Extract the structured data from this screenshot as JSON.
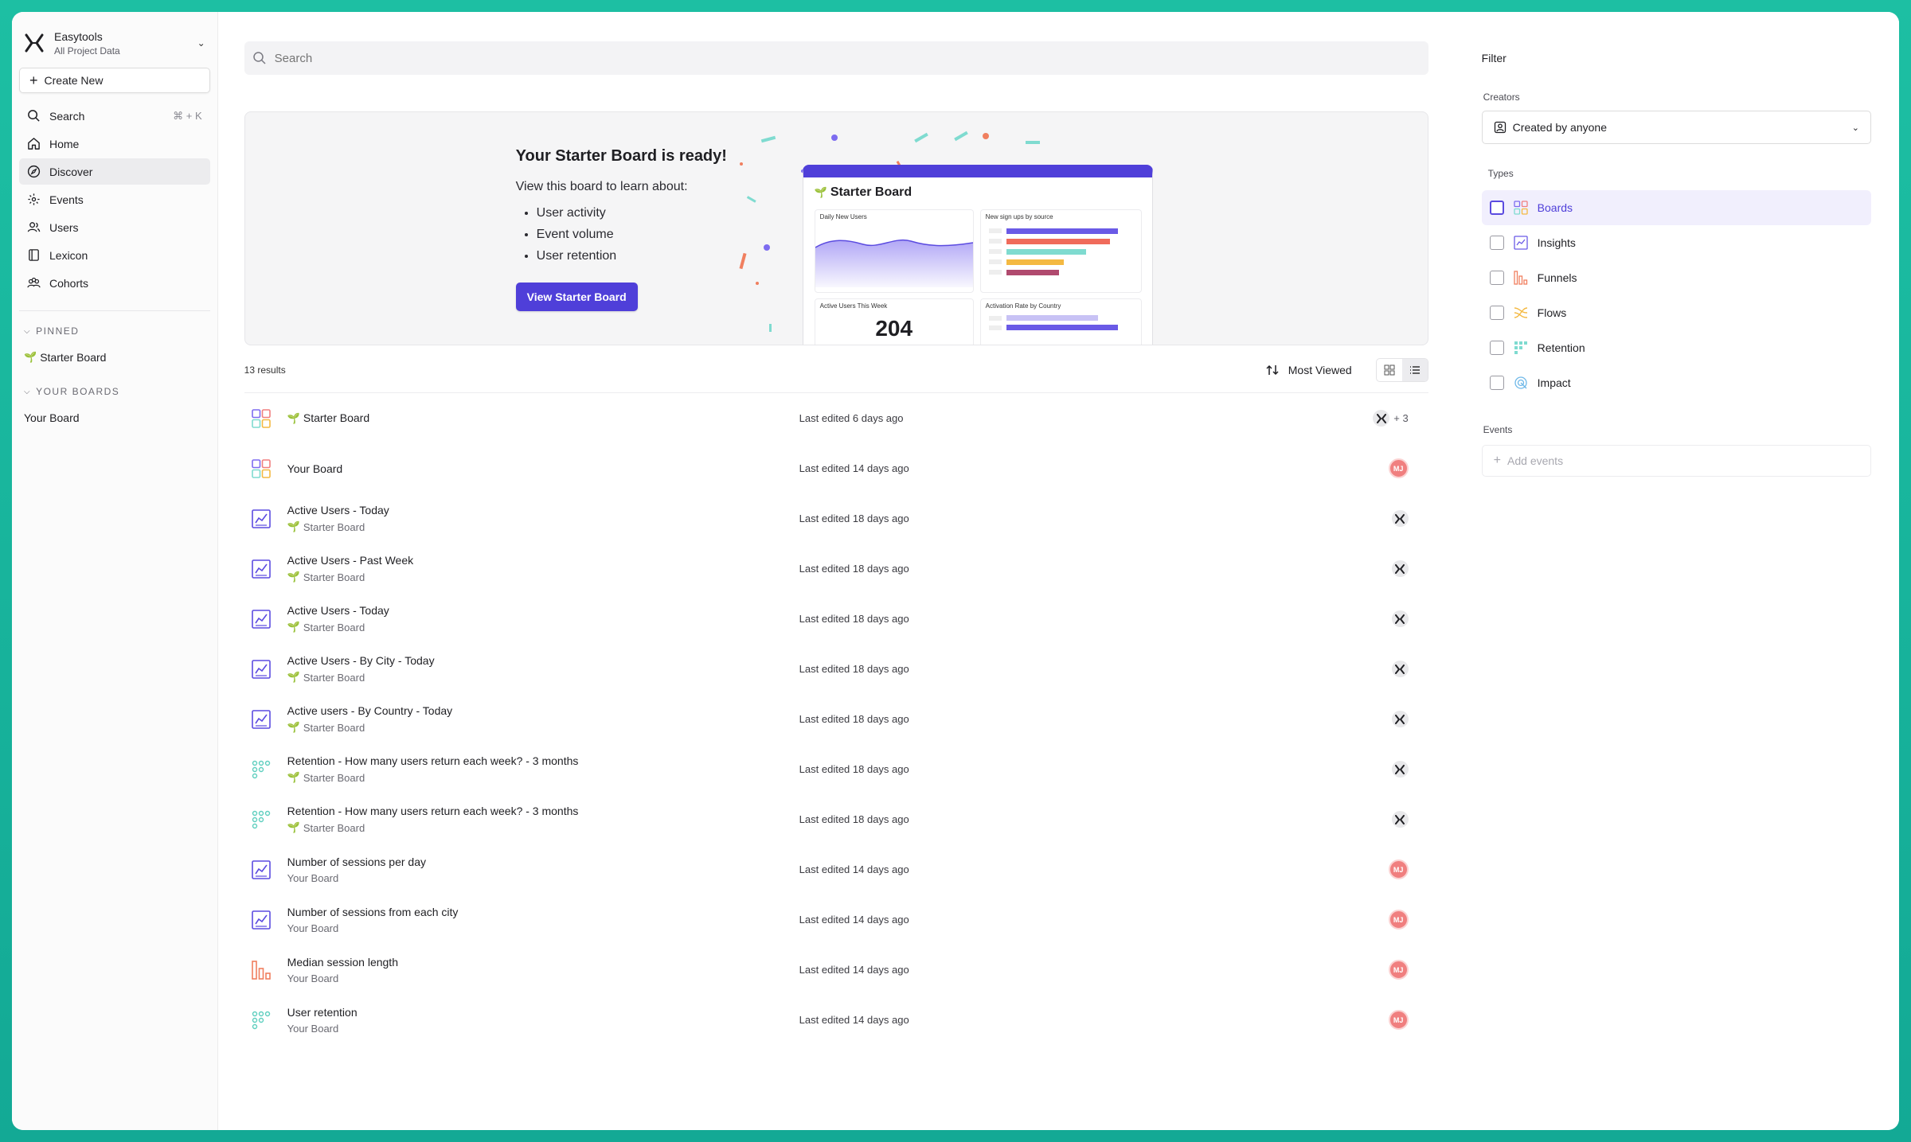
{
  "workspace": {
    "name": "Easytools",
    "subtitle": "All Project Data"
  },
  "sidebar": {
    "create_label": "Create New",
    "nav": [
      {
        "label": "Search",
        "icon": "search-icon",
        "shortcut": "⌘ + K"
      },
      {
        "label": "Home",
        "icon": "home-icon"
      },
      {
        "label": "Discover",
        "icon": "compass-icon",
        "active": true
      },
      {
        "label": "Events",
        "icon": "events-icon"
      },
      {
        "label": "Users",
        "icon": "users-icon"
      },
      {
        "label": "Lexicon",
        "icon": "book-icon"
      },
      {
        "label": "Cohorts",
        "icon": "cohorts-icon"
      }
    ],
    "pinned_label": "PINNED",
    "pinned_items": [
      "Starter Board"
    ],
    "boards_label": "YOUR BOARDS",
    "boards_items": [
      "Your Board"
    ]
  },
  "search": {
    "placeholder": "Search"
  },
  "banner": {
    "title": "Your Starter Board is ready!",
    "subtitle": "View this board to learn about:",
    "bullets": [
      "User activity",
      "Event volume",
      "User retention"
    ],
    "button_label": "View Starter Board",
    "preview": {
      "title": "Starter Board",
      "card1": "Daily New Users",
      "card2": "New sign ups by source",
      "card3": "Active Users This Week",
      "card3_value": "204",
      "card4": "Activation Rate by Country"
    }
  },
  "results": {
    "count_label": "13 results",
    "sort_label": "Most Viewed",
    "rows": [
      {
        "type": "board",
        "title": "Starter Board",
        "sprout": true,
        "sub": "",
        "edited": "Last edited 6 days ago",
        "owner": "x",
        "extra": "+ 3"
      },
      {
        "type": "board",
        "title": "Your Board",
        "sprout": false,
        "sub": "",
        "edited": "Last edited 14 days ago",
        "owner": "MJ",
        "extra": ""
      },
      {
        "type": "insight",
        "title": "Active Users - Today",
        "sub": "Starter Board",
        "subSprout": true,
        "edited": "Last edited 18 days ago",
        "owner": "x",
        "extra": ""
      },
      {
        "type": "insight",
        "title": "Active Users - Past Week",
        "sub": "Starter Board",
        "subSprout": true,
        "edited": "Last edited 18 days ago",
        "owner": "x",
        "extra": ""
      },
      {
        "type": "insight",
        "title": "Active Users - Today",
        "sub": "Starter Board",
        "subSprout": true,
        "edited": "Last edited 18 days ago",
        "owner": "x",
        "extra": ""
      },
      {
        "type": "insight",
        "title": "Active Users - By City - Today",
        "sub": "Starter Board",
        "subSprout": true,
        "edited": "Last edited 18 days ago",
        "owner": "x",
        "extra": ""
      },
      {
        "type": "insight",
        "title": "Active users - By Country - Today",
        "sub": "Starter Board",
        "subSprout": true,
        "edited": "Last edited 18 days ago",
        "owner": "x",
        "extra": ""
      },
      {
        "type": "retention",
        "title": "Retention - How many users return each week? - 3 months",
        "sub": "Starter Board",
        "subSprout": true,
        "edited": "Last edited 18 days ago",
        "owner": "x",
        "extra": ""
      },
      {
        "type": "retention",
        "title": "Retention - How many users return each week? - 3 months",
        "sub": "Starter Board",
        "subSprout": true,
        "edited": "Last edited 18 days ago",
        "owner": "x",
        "extra": ""
      },
      {
        "type": "insight",
        "title": "Number of sessions per day",
        "sub": "Your Board",
        "subSprout": false,
        "edited": "Last edited 14 days ago",
        "owner": "MJ",
        "extra": ""
      },
      {
        "type": "insight",
        "title": "Number of sessions from each city",
        "sub": "Your Board",
        "subSprout": false,
        "edited": "Last edited 14 days ago",
        "owner": "MJ",
        "extra": ""
      },
      {
        "type": "funnel",
        "title": "Median session length",
        "sub": "Your Board",
        "subSprout": false,
        "edited": "Last edited 14 days ago",
        "owner": "MJ",
        "extra": ""
      },
      {
        "type": "retention",
        "title": "User retention",
        "sub": "Your Board",
        "subSprout": false,
        "edited": "Last edited 14 days ago",
        "owner": "MJ",
        "extra": ""
      }
    ]
  },
  "filter": {
    "title": "Filter",
    "creators_label": "Creators",
    "creators_value": "Created by anyone",
    "types_label": "Types",
    "types": [
      {
        "label": "Boards",
        "icon": "boards-icon",
        "highlighted": true
      },
      {
        "label": "Insights",
        "icon": "insights-icon"
      },
      {
        "label": "Funnels",
        "icon": "funnels-icon"
      },
      {
        "label": "Flows",
        "icon": "flows-icon"
      },
      {
        "label": "Retention",
        "icon": "retention-icon"
      },
      {
        "label": "Impact",
        "icon": "impact-icon"
      }
    ],
    "events_label": "Events",
    "add_events_placeholder": "Add events"
  },
  "colors": {
    "accent": "#4f3fd9",
    "background": "#15b39c",
    "avatar": "#f07f7f"
  }
}
